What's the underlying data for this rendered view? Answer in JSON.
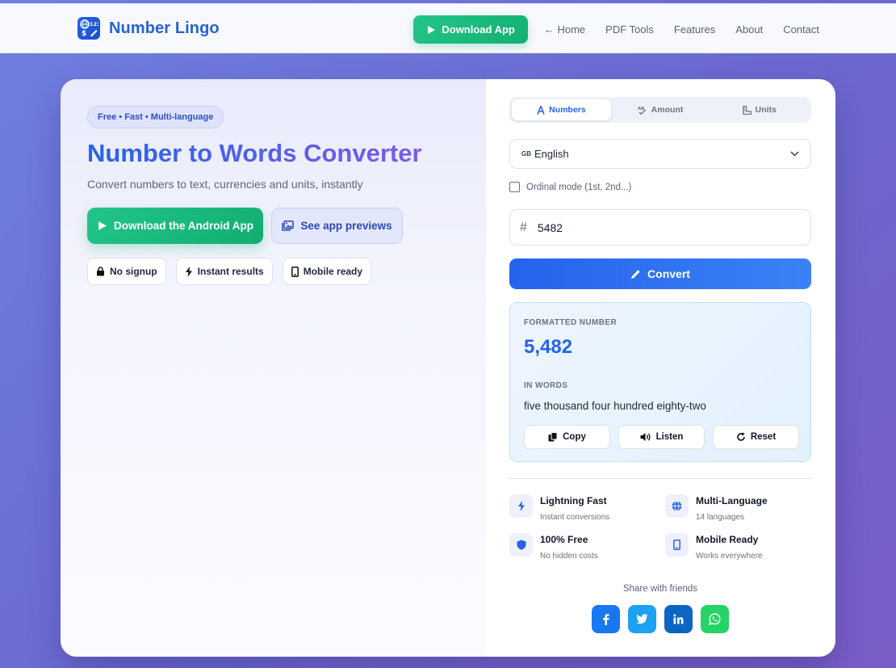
{
  "brand": {
    "name": "Number Lingo"
  },
  "nav": {
    "download_label": "Download App",
    "links": [
      "← Home",
      "PDF Tools",
      "Features",
      "About",
      "Contact"
    ]
  },
  "hero": {
    "badge": "Free • Fast • Multi-language",
    "title": "Number to Words Converter",
    "subtitle": "Convert numbers to text, currencies and units, instantly",
    "cta_primary": "Download the Android App",
    "cta_secondary": "See app previews",
    "chips": [
      "No signup",
      "Instant results",
      "Mobile ready"
    ]
  },
  "converter": {
    "tabs": [
      "Numbers",
      "Amount",
      "Units"
    ],
    "active_tab": "Numbers",
    "language_flag": "GB",
    "language": "English",
    "ordinal_label": "Ordinal mode (1st, 2nd...)",
    "input_value": "5482",
    "convert_label": "Convert",
    "result": {
      "formatted_label": "FORMATTED NUMBER",
      "formatted_value": "5,482",
      "words_label": "IN WORDS",
      "words_value": "five thousand four hundred eighty-two",
      "actions": [
        "Copy",
        "Listen",
        "Reset"
      ]
    }
  },
  "features": [
    {
      "title": "Lightning Fast",
      "subtitle": "Instant conversions",
      "icon": "bolt-icon"
    },
    {
      "title": "Multi-Language",
      "subtitle": "14 languages",
      "icon": "globe-icon"
    },
    {
      "title": "100% Free",
      "subtitle": "No hidden costs",
      "icon": "shield-icon"
    },
    {
      "title": "Mobile Ready",
      "subtitle": "Works everywhere",
      "icon": "mobile-icon"
    }
  ],
  "share": {
    "label": "Share with friends",
    "networks": [
      {
        "name": "facebook",
        "glyph": "f",
        "color": "#1877f2"
      },
      {
        "name": "twitter",
        "glyph": "t",
        "color": "#1da1f2"
      },
      {
        "name": "linkedin",
        "glyph": "in",
        "color": "#0a66c2"
      },
      {
        "name": "whatsapp",
        "glyph": "w",
        "color": "#25d366"
      }
    ]
  },
  "colors": {
    "primary": "#2563eb",
    "green": "#16b97a",
    "background": "#6b6fd6"
  }
}
